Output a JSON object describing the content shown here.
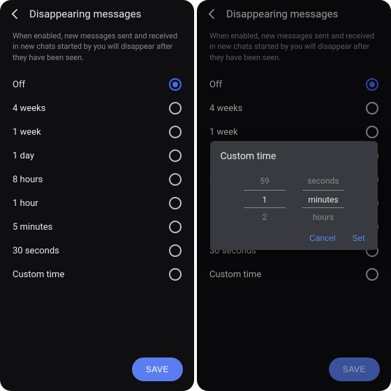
{
  "screen": {
    "title": "Disappearing messages",
    "description": "When enabled, new messages sent and received in new chats started by you will disappear after they have been seen.",
    "save_label": "SAVE",
    "selected_index": 0,
    "options": [
      {
        "label": "Off"
      },
      {
        "label": "4 weeks"
      },
      {
        "label": "1 week"
      },
      {
        "label": "1 day"
      },
      {
        "label": "8 hours"
      },
      {
        "label": "1 hour"
      },
      {
        "label": "5 minutes"
      },
      {
        "label": "30 seconds"
      },
      {
        "label": "Custom time"
      }
    ]
  },
  "dialog": {
    "title": "Custom time",
    "cancel_label": "Cancel",
    "set_label": "Set",
    "number_col": {
      "above": "59",
      "selected": "1",
      "below": "2"
    },
    "unit_col": {
      "above": "seconds",
      "selected": "minutes",
      "below": "hours"
    }
  }
}
